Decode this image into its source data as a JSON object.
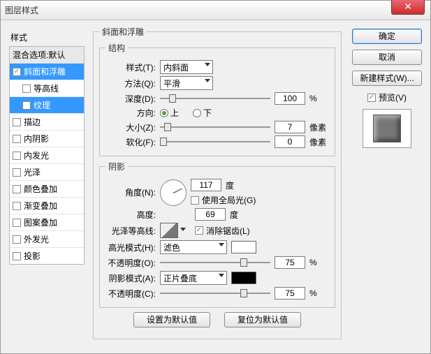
{
  "window": {
    "title": "图层样式"
  },
  "left": {
    "header": "样式",
    "items": [
      {
        "label": "混合选项:默认",
        "checked": null,
        "selected": false,
        "indent": false,
        "header": true
      },
      {
        "label": "斜面和浮雕",
        "checked": true,
        "selected": true,
        "indent": false
      },
      {
        "label": "等高线",
        "checked": false,
        "selected": false,
        "indent": true
      },
      {
        "label": "纹理",
        "checked": false,
        "selected": true,
        "indent": true
      },
      {
        "label": "描边",
        "checked": false,
        "selected": false,
        "indent": false
      },
      {
        "label": "内阴影",
        "checked": false,
        "selected": false,
        "indent": false
      },
      {
        "label": "内发光",
        "checked": false,
        "selected": false,
        "indent": false
      },
      {
        "label": "光泽",
        "checked": false,
        "selected": false,
        "indent": false
      },
      {
        "label": "颜色叠加",
        "checked": false,
        "selected": false,
        "indent": false
      },
      {
        "label": "渐变叠加",
        "checked": false,
        "selected": false,
        "indent": false
      },
      {
        "label": "图案叠加",
        "checked": false,
        "selected": false,
        "indent": false
      },
      {
        "label": "外发光",
        "checked": false,
        "selected": false,
        "indent": false
      },
      {
        "label": "投影",
        "checked": false,
        "selected": false,
        "indent": false
      }
    ]
  },
  "group_main": "斜面和浮雕",
  "group_struct": "结构",
  "group_shadow": "阴影",
  "struct": {
    "style_label": "样式(T):",
    "style_value": "内斜面",
    "method_label": "方法(Q):",
    "method_value": "平滑",
    "depth_label": "深度(D):",
    "depth_value": "100",
    "depth_unit": "%",
    "direction_label": "方向:",
    "dir_up": "上",
    "dir_down": "下",
    "size_label": "大小(Z):",
    "size_value": "7",
    "size_unit": "像素",
    "soften_label": "软化(F):",
    "soften_value": "0",
    "soften_unit": "像素"
  },
  "shadow": {
    "angle_label": "角度(N):",
    "angle_value": "117",
    "angle_unit": "度",
    "global_label": "使用全局光(G)",
    "altitude_label": "高度:",
    "altitude_value": "69",
    "altitude_unit": "度",
    "contour_label": "光泽等高线:",
    "antialias_label": "消除锯齿(L)",
    "hilite_mode_label": "高光模式(H):",
    "hilite_mode_value": "滤色",
    "hilite_op_label": "不透明度(O):",
    "hilite_op_value": "75",
    "hilite_op_unit": "%",
    "shadow_mode_label": "阴影模式(A):",
    "shadow_mode_value": "正片叠底",
    "shadow_op_label": "不透明度(C):",
    "shadow_op_value": "75",
    "shadow_op_unit": "%",
    "hilite_color": "#ffffff",
    "shadow_color": "#000000"
  },
  "buttons": {
    "ok": "确定",
    "cancel": "取消",
    "new_style": "新建样式(W)...",
    "preview": "预览(V)",
    "set_default": "设置为默认值",
    "reset_default": "复位为默认值"
  }
}
